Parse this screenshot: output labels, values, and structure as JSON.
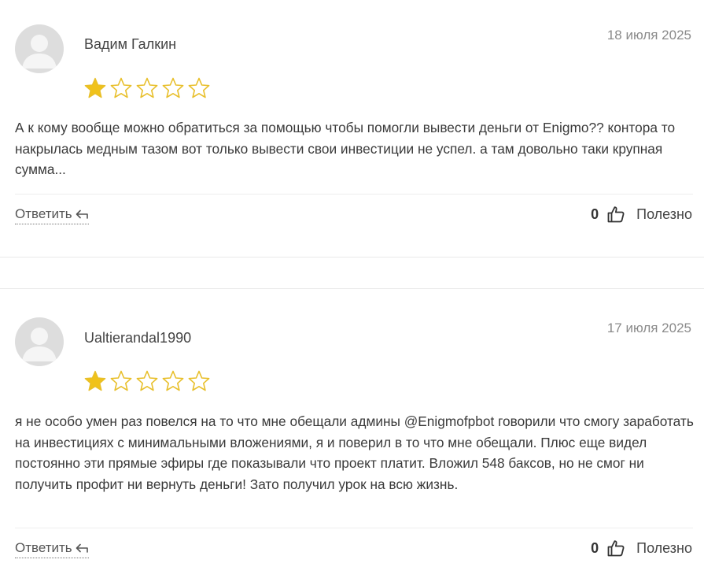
{
  "reviews": [
    {
      "author": "Вадим Галкин",
      "date": "18 июля 2025",
      "rating": 1,
      "max_rating": 5,
      "text": "А к кому вообще можно обратиться за помощью чтобы помогли вывести деньги от Enigmo?? контора то накрылась медным тазом вот только вывести свои инвестиции не успел. а там довольно таки крупная сумма...",
      "reply_label": "Ответить",
      "useful_count": "0",
      "useful_label": "Полезно"
    },
    {
      "author": "Ualtierandal1990",
      "date": "17 июля 2025",
      "rating": 1,
      "max_rating": 5,
      "text": "я не особо умен раз повелся на то что мне обещали админы @Enigmofpbot говорили что смогу заработать на инвестициях с минимальными вложениями, я и поверил в то что мне обещали. Плюс еще видел постоянно эти прямые эфиры где показывали что проект платит. Вложил 548 баксов, но не смог ни получить профит ни вернуть деньги! Зато получил урок на всю жизнь.",
      "reply_label": "Ответить",
      "useful_count": "0",
      "useful_label": "Полезно"
    }
  ],
  "colors": {
    "star_filled": "#f0c21a",
    "star_empty_stroke": "#e8bf2a",
    "avatar_bg": "#dddddd",
    "avatar_figure": "#f5f5f5"
  },
  "icons": {
    "avatar": "user-silhouette-icon",
    "reply": "reply-arrow-icon",
    "useful": "thumbs-up-icon",
    "star": "star-icon"
  }
}
